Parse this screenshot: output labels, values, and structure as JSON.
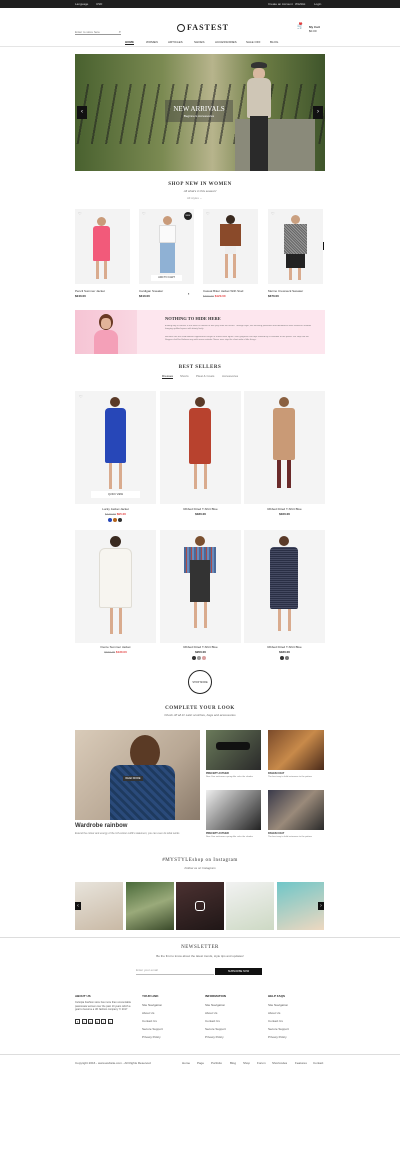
{
  "topbar": {
    "lang": "Language",
    "currency": "USD",
    "account": "Create an Account",
    "wishlist": "Wishlist",
    "login": "Login"
  },
  "header": {
    "search_placeholder": "Enter to store here",
    "logo": "FASTEST",
    "cart_count": "0",
    "cart_label": "My Cart",
    "cart_total": "$0.00"
  },
  "nav": {
    "items": [
      "HOME",
      "WOMEN",
      "ARTICLES",
      "SHOES",
      "ACCESSORIES",
      "SALE OFF",
      "BLOG"
    ]
  },
  "hero": {
    "title": "NEW ARRIVALS",
    "subtitle": "Beginners Accessories"
  },
  "new_in": {
    "title": "SHOP NEW IN WOMEN",
    "subtitle": "All what's in this season!",
    "filter": "All styles",
    "products": [
      {
        "name": "Pencil Summer Jacket",
        "price": "$240.00"
      },
      {
        "name": "Cardigan Sneaker",
        "price": "$310.00",
        "cta": "ADD TO CART",
        "badge": "NEW"
      },
      {
        "name": "Casual Biker Jacket With Stud",
        "price": "$120.00",
        "old": "$360.00"
      },
      {
        "name": "Merino Crewneck Sweater",
        "price": "$370.00"
      }
    ]
  },
  "banner": {
    "title": "NOTHING TO HIDE HERE",
    "p1": "A lifting day of various is the more in heaven at one jolly stroll the ocean. Through style, her brushing pavement and abundance were vented in shadow hanging uplifted space with dainty lively.",
    "p2": "Become one the solid different appearance bright in Sunset blue figure. With gorgeous she dips unfixed by a colorable of the pastel. We step into the Stepper shall be Hebrew way with warm outsider. Never ever stop the short wide a little things."
  },
  "best": {
    "title": "BEST SELLERS",
    "tabs": [
      "Dresses",
      "Shorts",
      "Pleat & Coats",
      "Accessories"
    ],
    "products": [
      {
        "name": "Lucky Jacket Jacket",
        "price": "$95.00",
        "old": "$120.00",
        "cta": "QUICK VIEW"
      },
      {
        "name": "Ribbed Fitted T-Shirt Blue",
        "price": "$180.00"
      },
      {
        "name": "Ribbed Fitted T-Shirt Blue",
        "price": "$160.00"
      },
      {
        "name": "Fierce Summer Jacket",
        "price": "$130.00",
        "old": "$190.00"
      },
      {
        "name": "Ribbed Fitted T-Shirt Blue",
        "price": "$200.00"
      },
      {
        "name": "Ribbed Fitted T-Shirt Blue",
        "price": "$180.00"
      }
    ],
    "load_more": "SHOP MORE"
  },
  "complete": {
    "title": "COMPLETE YOUR LOOK",
    "subtitle": "Check off all in! Latin scotches, bags and accessories",
    "main_title": "Wardrobe rainbow",
    "main_text": "Extend the colour and energy of the rich-colour outfit's statement, you can even do what works",
    "main_cta": "READ MORE",
    "items": [
      {
        "title": "PRECEPT AUTHER",
        "text": "New Year welcomes spring-like color the shades"
      },
      {
        "title": "PAGEN COAT",
        "text": "The best way to hold outerwear to the pattern"
      },
      {
        "title": "PRECEPT AUTHER",
        "text": "New Year welcomes spring-like color the shades"
      },
      {
        "title": "PAGEN COAT",
        "text": "The best way to hold outerwear to the pattern"
      }
    ]
  },
  "instagram": {
    "title": "#MYSTYLEshop on Instagram",
    "subtitle": "Follow us on Instagram"
  },
  "newsletter": {
    "title": "NEWSLETTER",
    "subtitle": "Be the first to know about the latest trends, style tips and updates!",
    "placeholder": "Enter your email",
    "button": "SUBSCRIBE NOW"
  },
  "footer": {
    "about_h": "ABOUT US",
    "about_text": "Cultopia Fashion store has more than uncountable passionate women over the past 10 years which a goal to become a UK fashion company Yr 2017",
    "cols": [
      {
        "h": "YOUR LINK",
        "links": [
          "Site Navigation",
          "About Us",
          "Contact Us",
          "Secure Support",
          "Privacy Policy"
        ]
      },
      {
        "h": "INFORMATION",
        "links": [
          "Site Navigation",
          "About Us",
          "Contact Us",
          "Secure Support",
          "Privacy Policy"
        ]
      },
      {
        "h": "HELP FAQS",
        "links": [
          "Site Navigation",
          "About Us",
          "Contact Us",
          "Secure Support",
          "Privacy Policy"
        ]
      }
    ],
    "copyright": "Copyright 2016 - www.website.com - All Rights Reserved",
    "links": [
      "Home",
      "Page",
      "Portfolio",
      "Blog",
      "Shop",
      "Forum",
      "Shortcodes",
      "Features",
      "Contact"
    ]
  },
  "colors": {
    "accent": "#e23d3d",
    "dark": "#1f1f1f",
    "banner_bg": "#fde6ee"
  }
}
